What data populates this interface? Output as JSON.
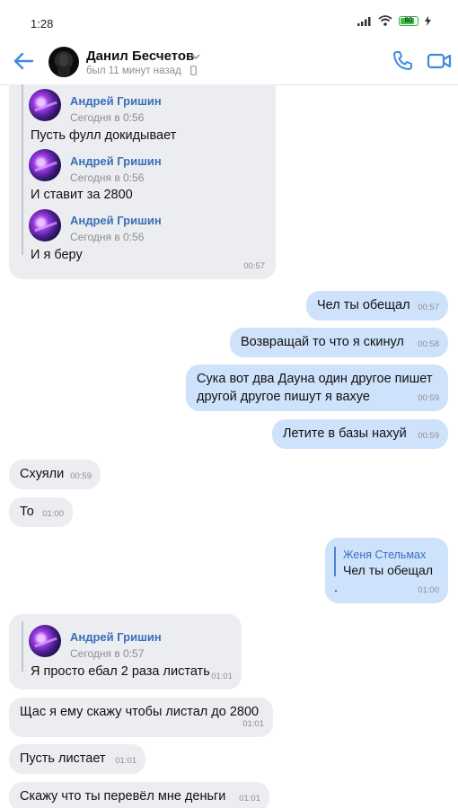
{
  "status": {
    "time": "1:28",
    "battery": "80"
  },
  "header": {
    "name": "Данил Бесчетов",
    "status": "был 11 минут назад"
  },
  "messages": {
    "m1": {
      "fwd": [
        {
          "name": "Андрей Гришин",
          "date": "Сегодня в 0:56",
          "text": "Пусть фулл докидывает"
        },
        {
          "name": "Андрей Гришин",
          "date": "Сегодня в 0:56",
          "text": "И ставит за 2800"
        },
        {
          "name": "Андрей Гришин",
          "date": "Сегодня в 0:56",
          "text": "И я беру"
        }
      ],
      "time": "00:57"
    },
    "m2": {
      "text": "Чел ты обещал",
      "time": "00:57"
    },
    "m3": {
      "text": "Возвращай то что я скинул",
      "time": "00:58"
    },
    "m4": {
      "line1": "Сука вот два Дауна один другое пишет",
      "line2": "другой другое пишут я вахуе",
      "time": "00:59"
    },
    "m5": {
      "text": "Летите в базы нахуй",
      "time": "00:59"
    },
    "m6": {
      "text": "Схуяли",
      "time": "00:59"
    },
    "m7": {
      "text": "То",
      "time": "01:00"
    },
    "m8": {
      "fwd_name": "Женя Стельмах",
      "fwd_text": "Чел ты обещал",
      "text": ".",
      "time": "01:00"
    },
    "m9": {
      "fwd_name": "Андрей Гришин",
      "fwd_date": "Сегодня в 0:57",
      "text": "Я просто ебал 2 раза листать",
      "time": "01:01"
    },
    "m10": {
      "text": "Щас я ему скажу чтобы листал до 2800",
      "time": "01:01"
    },
    "m11": {
      "text": "Пусть листает",
      "time": "01:01"
    },
    "m12": {
      "text": "Скажу что ты перевёл мне деньги",
      "time": "01:01"
    }
  }
}
